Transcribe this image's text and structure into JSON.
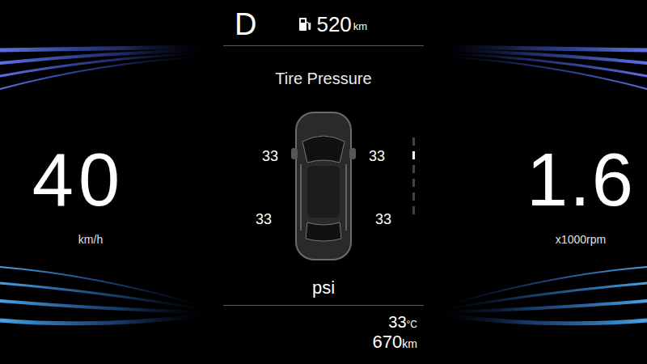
{
  "gear": "D",
  "fuel_range": {
    "value": "520",
    "unit": "km"
  },
  "panel_title": "Tire Pressure",
  "tires": [
    {
      "position": "front-left",
      "value": "33"
    },
    {
      "position": "front-right",
      "value": "33"
    },
    {
      "position": "rear-left",
      "value": "33"
    },
    {
      "position": "rear-right",
      "value": "33"
    }
  ],
  "pressure_unit": "psi",
  "speed": {
    "value": "40",
    "unit": "km/h"
  },
  "rpm": {
    "value": "1.6",
    "unit": "x1000rpm"
  },
  "temperature": {
    "value": "33",
    "unit": "°C"
  },
  "odometer": {
    "value": "670",
    "unit": "km"
  }
}
